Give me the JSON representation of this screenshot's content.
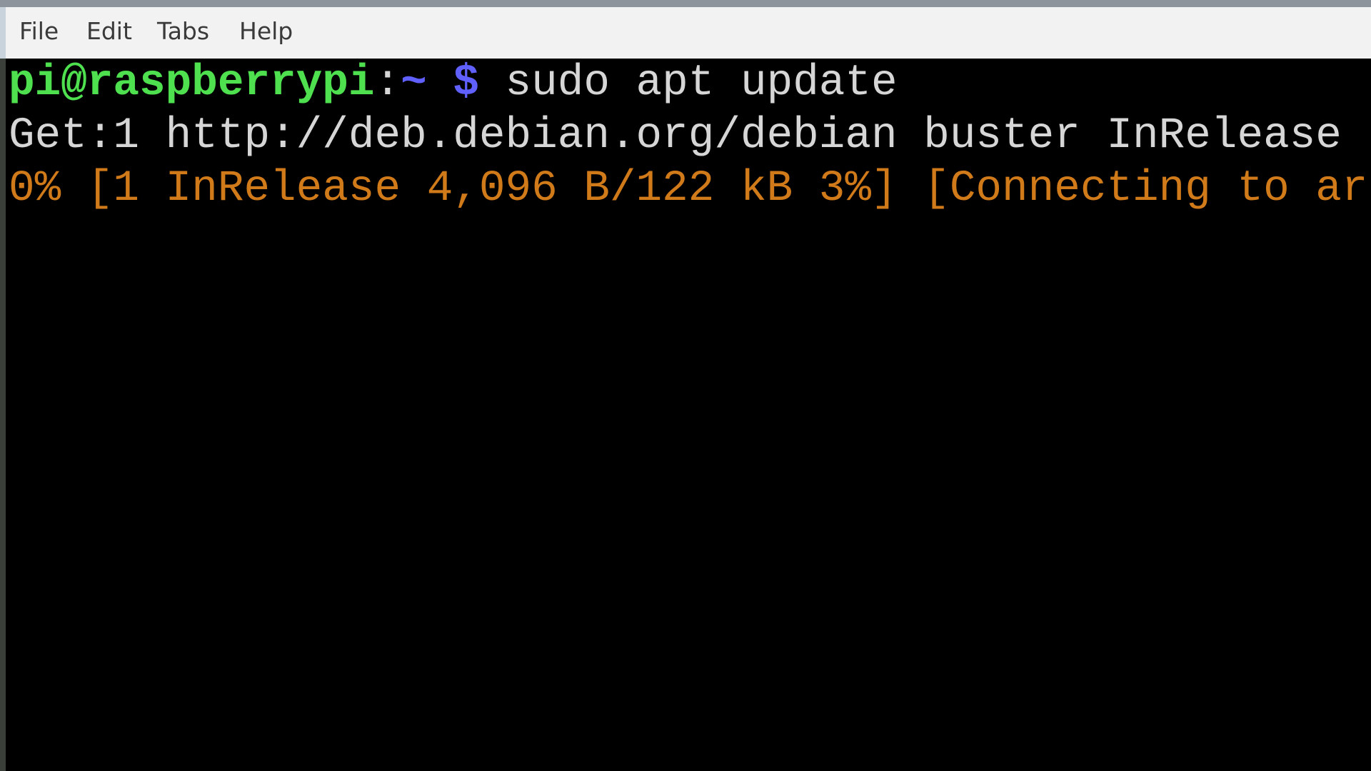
{
  "menu": {
    "items": [
      "File",
      "Edit",
      "Tabs",
      "Help"
    ]
  },
  "terminal": {
    "prompt_user_host": "pi@raspberrypi",
    "prompt_sep": ":",
    "prompt_path": "~",
    "prompt_symbol": "$",
    "command": "sudo apt update",
    "output_line_1": "Get:1 http://deb.debian.org/debian buster InRelease",
    "progress_line": "0% [1 InRelease 4,096 B/122 kB 3%] [Connecting to ar"
  },
  "colors": {
    "prompt_user": "#4ee04e",
    "prompt_path": "#6060ff",
    "output": "#d6d6d6",
    "progress": "#d07a1a"
  }
}
